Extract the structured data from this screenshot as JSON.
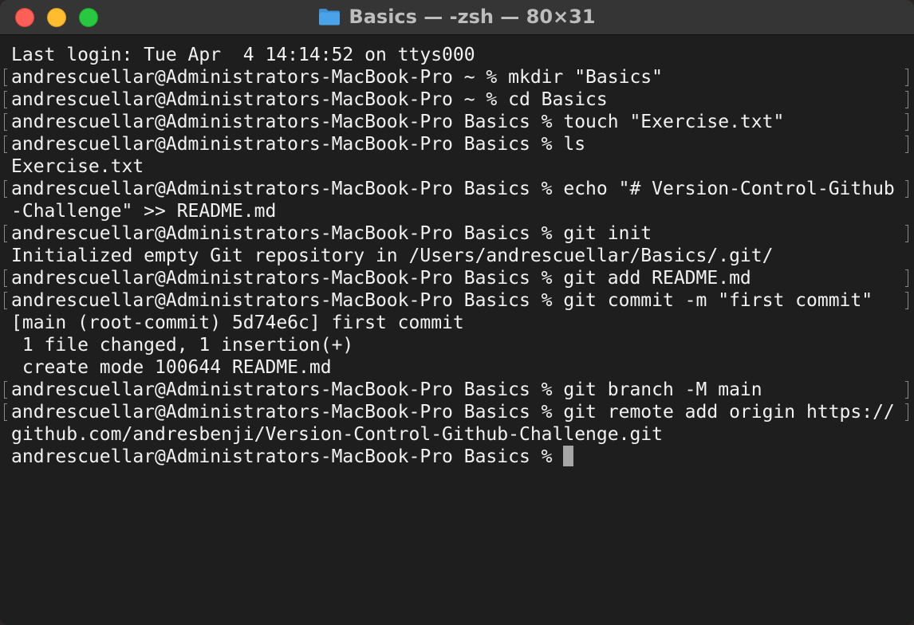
{
  "window": {
    "title": "Basics — -zsh — 80×31",
    "folder_icon": "folder-icon",
    "colors": {
      "close": "#fe5f57",
      "minimize": "#febc2e",
      "zoom": "#28c840",
      "folder": "#4aa3e8"
    }
  },
  "terminal": {
    "lines": [
      {
        "text": "Last login: Tue Apr  4 14:14:52 on ttys000",
        "marked": false
      },
      {
        "text": "andrescuellar@Administrators-MacBook-Pro ~ % mkdir \"Basics\"",
        "marked": true
      },
      {
        "text": "andrescuellar@Administrators-MacBook-Pro ~ % cd Basics",
        "marked": true
      },
      {
        "text": "andrescuellar@Administrators-MacBook-Pro Basics % touch \"Exercise.txt\"",
        "marked": true
      },
      {
        "text": "andrescuellar@Administrators-MacBook-Pro Basics % ls",
        "marked": true
      },
      {
        "text": "Exercise.txt",
        "marked": false
      },
      {
        "text": "andrescuellar@Administrators-MacBook-Pro Basics % echo \"# Version-Control-Github",
        "marked": true
      },
      {
        "text": "-Challenge\" >> README.md",
        "marked": false
      },
      {
        "text": "andrescuellar@Administrators-MacBook-Pro Basics % git init",
        "marked": true
      },
      {
        "text": "Initialized empty Git repository in /Users/andrescuellar/Basics/.git/",
        "marked": false
      },
      {
        "text": "andrescuellar@Administrators-MacBook-Pro Basics % git add README.md",
        "marked": true
      },
      {
        "text": "andrescuellar@Administrators-MacBook-Pro Basics % git commit -m \"first commit\"",
        "marked": true
      },
      {
        "text": "[main (root-commit) 5d74e6c] first commit",
        "marked": false
      },
      {
        "text": " 1 file changed, 1 insertion(+)",
        "marked": false
      },
      {
        "text": " create mode 100644 README.md",
        "marked": false
      },
      {
        "text": "andrescuellar@Administrators-MacBook-Pro Basics % git branch -M main",
        "marked": true
      },
      {
        "text": "andrescuellar@Administrators-MacBook-Pro Basics % git remote add origin https://",
        "marked": true
      },
      {
        "text": "github.com/andresbenji/Version-Control-Github-Challenge.git",
        "marked": false
      }
    ],
    "prompt": "andrescuellar@Administrators-MacBook-Pro Basics % "
  }
}
